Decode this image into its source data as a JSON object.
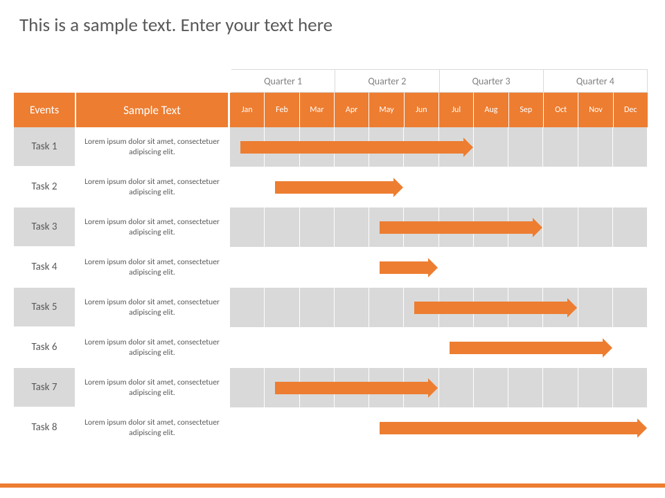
{
  "title": "This is a sample text. Enter your text here",
  "headers": {
    "events": "Events",
    "sample": "Sample Text"
  },
  "quarters": [
    "Quarter 1",
    "Quarter 2",
    "Quarter 3",
    "Quarter 4"
  ],
  "months": [
    "Jan",
    "Feb",
    "Mar",
    "Apr",
    "May",
    "Jun",
    "Jul",
    "Aug",
    "Sep",
    "Oct",
    "Nov",
    "Dec"
  ],
  "rows": [
    {
      "task": "Task 1",
      "desc": "Lorem ipsum dolor sit amet, consectetuer adipiscing elit."
    },
    {
      "task": "Task 2",
      "desc": "Lorem ipsum dolor sit amet, consectetuer adipiscing elit."
    },
    {
      "task": "Task 3",
      "desc": "Lorem ipsum dolor sit amet, consectetuer adipiscing elit."
    },
    {
      "task": "Task 4",
      "desc": "Lorem ipsum dolor sit amet, consectetuer adipiscing elit."
    },
    {
      "task": "Task 5",
      "desc": "Lorem ipsum dolor sit amet, consectetuer adipiscing elit."
    },
    {
      "task": "Task 6",
      "desc": "Lorem ipsum dolor sit amet, consectetuer adipiscing elit."
    },
    {
      "task": "Task 7",
      "desc": "Lorem ipsum dolor sit amet, consectetuer adipiscing elit."
    },
    {
      "task": "Task 8",
      "desc": "Lorem ipsum dolor sit amet, consectetuer adipiscing elit."
    }
  ],
  "chart_data": {
    "type": "bar",
    "title": "This is a sample text. Enter your text here",
    "xlabel": "",
    "ylabel": "",
    "categories": [
      "Jan",
      "Feb",
      "Mar",
      "Apr",
      "May",
      "Jun",
      "Jul",
      "Aug",
      "Sep",
      "Oct",
      "Nov",
      "Dec"
    ],
    "series": [
      {
        "name": "Task 1",
        "start": 1,
        "end": 7
      },
      {
        "name": "Task 2",
        "start": 2,
        "end": 5
      },
      {
        "name": "Task 3",
        "start": 5,
        "end": 9
      },
      {
        "name": "Task 4",
        "start": 5,
        "end": 6
      },
      {
        "name": "Task 5",
        "start": 6,
        "end": 10
      },
      {
        "name": "Task 6",
        "start": 7,
        "end": 11
      },
      {
        "name": "Task 7",
        "start": 2,
        "end": 6
      },
      {
        "name": "Task 8",
        "start": 5,
        "end": 12
      }
    ],
    "xlim": [
      1,
      12
    ]
  },
  "colors": {
    "accent": "#ed7d31"
  }
}
